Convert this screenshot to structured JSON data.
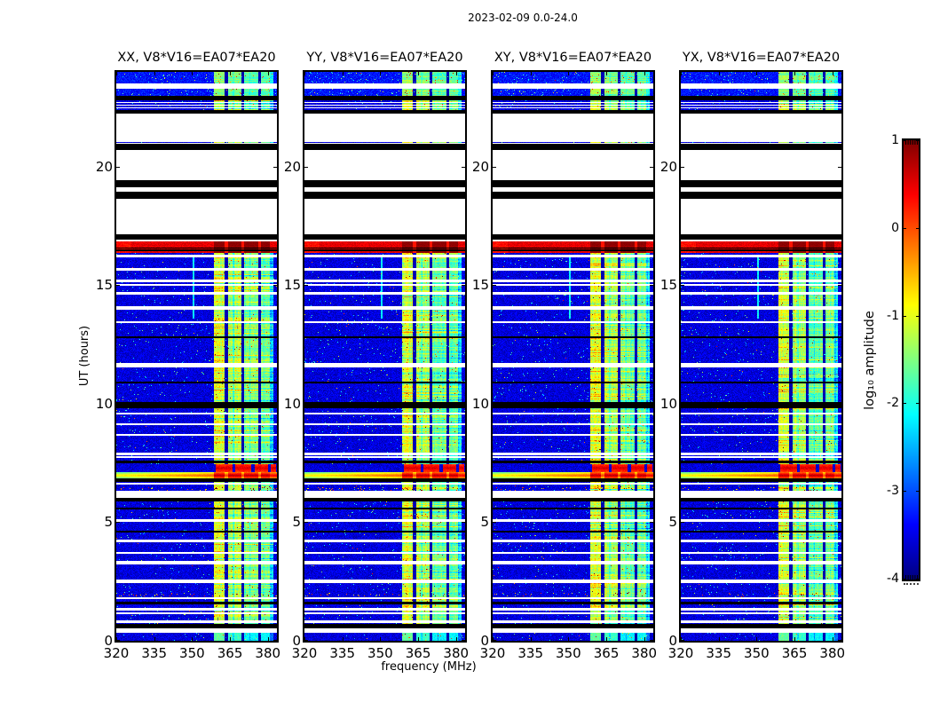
{
  "figure": {
    "background": "#ffffff"
  },
  "chart_data": {
    "type": "heatmap",
    "title": "2023-02-09 0.0-24.0",
    "xlabel": "frequency (MHz)",
    "ylabel": "UT (hours)",
    "xlim": [
      320,
      383.6
    ],
    "ylim": [
      0,
      24
    ],
    "xticks": [
      320,
      335,
      350,
      365,
      380
    ],
    "yticks": [
      0,
      5,
      10,
      15,
      20
    ],
    "grid": false,
    "panels": [
      {
        "id": "xx",
        "title": "XX, V8*V16=EA07*EA20",
        "seed": 11
      },
      {
        "id": "yy",
        "title": "YY, V8*V16=EA07*EA20",
        "seed": 23
      },
      {
        "id": "xy",
        "title": "XY, V8*V16=EA07*EA20",
        "seed": 37
      },
      {
        "id": "yx",
        "title": "YX, V8*V16=EA07*EA20",
        "seed": 51
      }
    ],
    "colorbar": {
      "label": "log₁₀ amplitude",
      "colormap": "jet",
      "vmin": -4,
      "vmax": 1,
      "tick_values": [
        1,
        0,
        -1,
        -2,
        -3,
        -4
      ],
      "tick_labels": [
        "1",
        "0",
        "-1",
        "-2",
        "-3",
        "-4"
      ]
    },
    "features": {
      "background_level": -3.55,
      "rfi_band": [
        358.8,
        382.3
      ],
      "rfi_segments": [
        [
          358.8,
          363.0,
          -1.1
        ],
        [
          364.2,
          369.5,
          -1.3
        ],
        [
          370.5,
          376.2,
          -1.62
        ],
        [
          377.2,
          380.8,
          -1.6
        ],
        [
          380.8,
          382.3,
          -2.3
        ]
      ],
      "rfi_dips": [
        366.4,
        372.9
      ],
      "white_rows": [
        [
          23.3,
          23.5
        ],
        [
          21.05,
          22.25
        ],
        [
          20.95,
          21.02
        ],
        [
          19.45,
          20.7
        ],
        [
          18.95,
          19.15
        ],
        [
          17.15,
          18.65
        ],
        [
          16.85,
          16.92
        ],
        [
          16.17,
          16.27
        ],
        [
          15.63,
          15.72
        ],
        [
          15.14,
          15.22
        ],
        [
          14.98,
          15.06
        ],
        [
          14.62,
          14.7
        ],
        [
          13.96,
          14.1
        ],
        [
          13.4,
          13.49
        ],
        [
          11.54,
          11.71
        ],
        [
          9.55,
          9.63
        ],
        [
          9.1,
          9.18
        ],
        [
          8.64,
          8.72
        ],
        [
          7.84,
          7.93
        ],
        [
          7.71,
          7.79
        ],
        [
          6.58,
          6.68
        ],
        [
          6.02,
          6.32
        ],
        [
          5.03,
          5.12
        ],
        [
          4.16,
          4.25
        ],
        [
          3.66,
          3.74
        ],
        [
          3.21,
          3.36
        ],
        [
          2.42,
          2.57
        ],
        [
          1.76,
          1.85
        ],
        [
          1.28,
          1.37
        ],
        [
          1.12,
          1.2
        ],
        [
          0.76,
          0.85
        ],
        [
          0.34,
          0.52
        ]
      ],
      "black_rows": [
        [
          22.8,
          23.0
        ],
        [
          22.25,
          22.4
        ],
        [
          20.7,
          20.95
        ],
        [
          19.15,
          19.45
        ],
        [
          18.65,
          18.95
        ],
        [
          16.92,
          17.15
        ],
        [
          16.545,
          16.59
        ],
        [
          16.448,
          16.493
        ],
        [
          12.75,
          12.86
        ],
        [
          10.84,
          10.95
        ],
        [
          9.82,
          10.08
        ],
        [
          7.48,
          7.61
        ],
        [
          6.72,
          6.85
        ],
        [
          5.86,
          6.01
        ],
        [
          5.54,
          5.63
        ],
        [
          4.55,
          4.64
        ],
        [
          1.52,
          1.65
        ],
        [
          0.52,
          0.72
        ]
      ],
      "red_band": [
        16.35,
        16.85
      ],
      "blob_rows": [
        7.12,
        7.46
      ],
      "blob_segments": [
        [
          359.5,
          365.9
        ],
        [
          367.2,
          373.5
        ],
        [
          374.8,
          380.1
        ],
        [
          381.0,
          383.4
        ]
      ],
      "bright_line": [
        6.85,
        7.1
      ],
      "stripe_pattern_zone": [
        22.4,
        22.8
      ],
      "top_bright_above": 23.0,
      "bottom_rfi_below": 0.36,
      "speckle_rows": [
        [
          1.88,
          2.01
        ],
        [
          6.33,
          6.46
        ]
      ],
      "cyan_streak": {
        "freq": [
          350.1,
          350.9
        ],
        "hours": [
          13.6,
          16.2
        ]
      }
    }
  }
}
